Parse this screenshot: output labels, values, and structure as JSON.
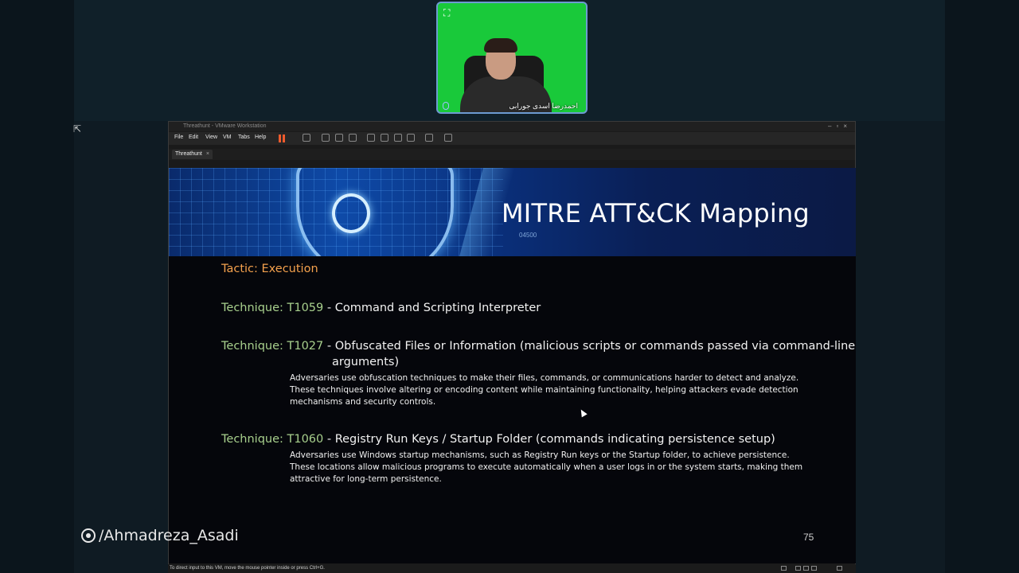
{
  "webcam": {
    "name": "احمدرضا اسدی جورابی"
  },
  "vm": {
    "window_title": "Threathunt - VMware Workstation",
    "menus": [
      "File",
      "Edit",
      "View",
      "VM",
      "Tabs",
      "Help"
    ],
    "tab_label": "Threathunt",
    "status_text": "To direct input to this VM, move the mouse pointer inside or press Ctrl+G."
  },
  "slide": {
    "title": "MITRE ATT&CK Mapping",
    "banner_digits": "04500",
    "tactic": "Tactic: Execution",
    "techniques": [
      {
        "id": "Technique: T1059",
        "name": " - Command and Scripting Interpreter"
      },
      {
        "id": "Technique: T1027",
        "name": " - Obfuscated Files or Information (malicious scripts or commands passed via command-line",
        "name_cont": "arguments)",
        "desc": "Adversaries use obfuscation techniques to make their files, commands, or communications harder to detect and analyze. These techniques involve altering or encoding content while maintaining functionality, helping attackers evade detection mechanisms and security controls."
      },
      {
        "id": "Technique: T1060",
        "name": " - Registry Run Keys / Startup Folder (commands indicating persistence setup)",
        "desc": "Adversaries use Windows startup mechanisms, such as Registry Run keys or the Startup folder, to achieve persistence. These locations allow malicious programs to execute automatically when a user logs in or the system starts, making them attractive for long-term persistence."
      }
    ],
    "page_number": "75"
  },
  "watermark": "/Ahmadreza_Asadi",
  "colors": {
    "tactic": "#f4a14d",
    "technique_id": "#a8d08d",
    "pause_button": "#f05b2d",
    "webcam_bg": "#19c93a"
  },
  "icons": [
    "expand-icon",
    "mic-icon",
    "share-screen-icon",
    "pause-icon",
    "reel-icon"
  ]
}
